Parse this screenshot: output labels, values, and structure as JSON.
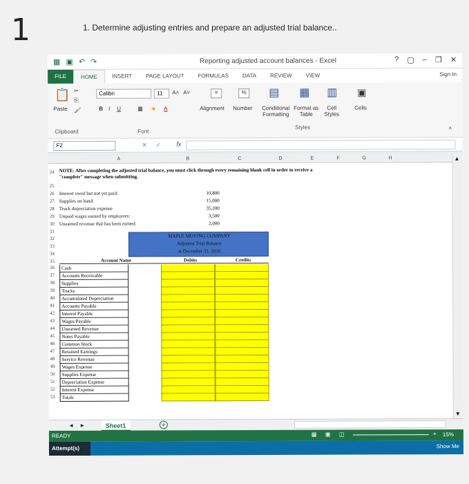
{
  "question": {
    "number": "1",
    "text": "1. Determine adjusting entries and prepare an adjusted trial balance.."
  },
  "window": {
    "title": "Reporting adjusted account balances - Excel",
    "help": "?",
    "sign_in": "Sign In"
  },
  "ribbon": {
    "tabs": [
      "FILE",
      "HOME",
      "INSERT",
      "PAGE LAYOUT",
      "FORMULAS",
      "DATA",
      "REVIEW",
      "VIEW"
    ],
    "paste": "Paste",
    "clipboard": "Clipboard",
    "font_name": "Calibri",
    "font_size": "11",
    "font_group": "Font",
    "alignment": "Alignment",
    "number": "Number",
    "conditional_formatting": "Conditional Formatting",
    "format_as_table": "Format as Table",
    "cell_styles": "Cell Styles",
    "styles": "Styles",
    "cells": "Cells"
  },
  "formula_bar": {
    "name_box": "F2",
    "fx": "fx"
  },
  "columns": [
    "A",
    "B",
    "C",
    "D",
    "E",
    "F",
    "G",
    "H"
  ],
  "note": "NOTE: After completing the adjusted trial balance, you must click through every remaining blank cell in order to receive a \"complete\" message when submitting.",
  "info_rows": [
    {
      "row": "26",
      "label": "Interest owed but not yet paid:",
      "value": "10,800"
    },
    {
      "row": "27",
      "label": "Supplies on hand:",
      "value": "15,000"
    },
    {
      "row": "28",
      "label": "Truck depreciation expense",
      "value": "35,200"
    },
    {
      "row": "29",
      "label": "Unpaid wages earned by employees:",
      "value": "3,500"
    },
    {
      "row": "30",
      "label": "Unearned revenue that has been earned:",
      "value": "2,000"
    }
  ],
  "header_block": {
    "company": "MAPLE MOVING COMPANY",
    "title": "Adjusted Trial Balance",
    "date": "at December 31, 2016"
  },
  "table_headers": {
    "account": "Account Name",
    "debits": "Debits",
    "credits": "Credits"
  },
  "accounts": [
    {
      "row": "36",
      "name": "Cash"
    },
    {
      "row": "37",
      "name": "Accounts Receivable"
    },
    {
      "row": "38",
      "name": "Supplies"
    },
    {
      "row": "39",
      "name": "Trucks"
    },
    {
      "row": "40",
      "name": "Accumulated Depreciation"
    },
    {
      "row": "41",
      "name": "Accounts Payable"
    },
    {
      "row": "42",
      "name": "Interest Payable"
    },
    {
      "row": "43",
      "name": "Wages Payable"
    },
    {
      "row": "44",
      "name": "Unearned Revenue"
    },
    {
      "row": "45",
      "name": "Notes Payable"
    },
    {
      "row": "46",
      "name": "Common Stock"
    },
    {
      "row": "47",
      "name": "Retained Earnings"
    },
    {
      "row": "48",
      "name": "Service Revenue"
    },
    {
      "row": "49",
      "name": "Wages Expense"
    },
    {
      "row": "50",
      "name": "Supplies Expense"
    },
    {
      "row": "51",
      "name": "Depreciation Expense"
    },
    {
      "row": "52",
      "name": "Interest Expense"
    },
    {
      "row": "53",
      "name": "Totals"
    }
  ],
  "row_labels": {
    "r24": "24",
    "r25": "25",
    "r31": "31",
    "r32": "32",
    "r33": "33",
    "r34": "34",
    "r35": "35"
  },
  "sheet_tab": "Sheet1",
  "status": {
    "ready": "READY",
    "zoom": "15%"
  },
  "attempt": {
    "label": "Attempt(s)",
    "show_me": "Show Me"
  }
}
